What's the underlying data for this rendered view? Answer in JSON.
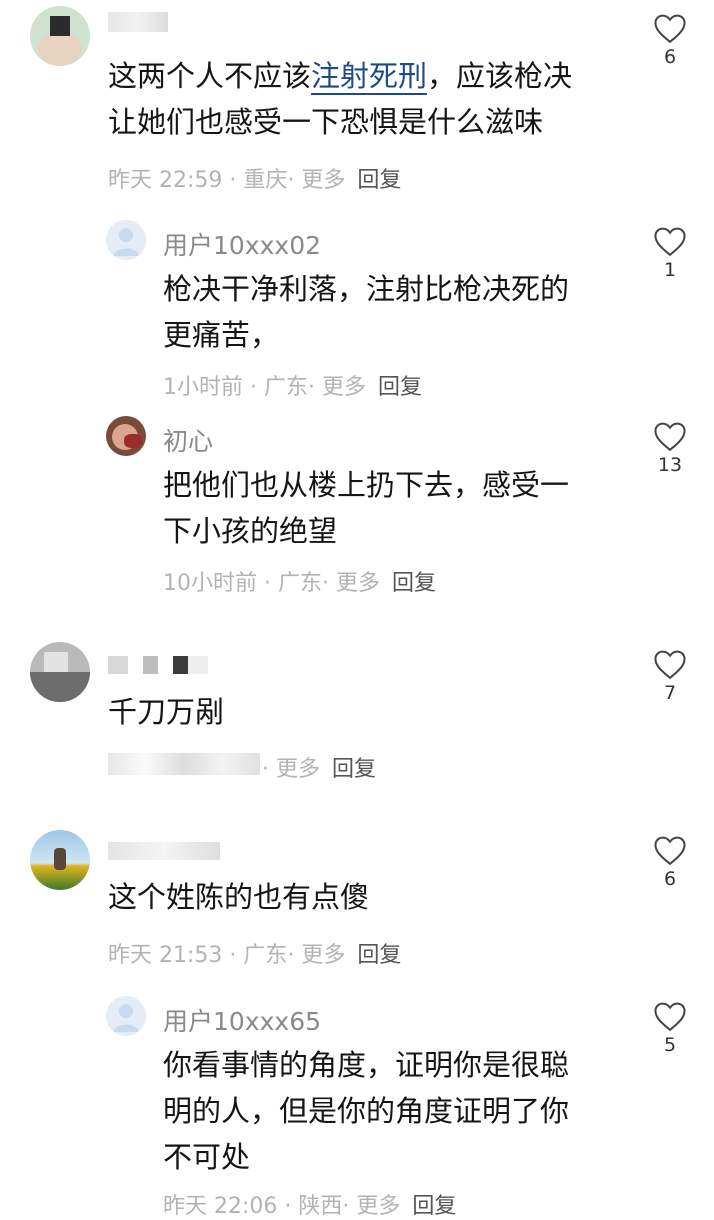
{
  "comments": [
    {
      "name": "",
      "text_before": "这两个人不应该",
      "text_link": "注射死刑",
      "text_after": "，应该枪决\n让她们也感受一下恐惧是什么滋味",
      "meta": "昨天 22:59 · 重庆· 更多",
      "reply": "回复",
      "likes": "6"
    },
    {
      "name": "用户10xxx02",
      "text": "枪决干净利落，注射比枪决死的\n更痛苦，",
      "meta": "1小时前 · 广东· 更多",
      "reply": "回复",
      "likes": "1"
    },
    {
      "name": "初心",
      "text": "把他们也从楼上扔下去，感受一\n下小孩的绝望",
      "meta": "10小时前 · 广东· 更多",
      "reply": "回复",
      "likes": "13"
    },
    {
      "name": "",
      "text": "千刀万剐",
      "meta": "· 更多",
      "reply": "回复",
      "likes": "7"
    },
    {
      "name": "",
      "text": "这个姓陈的也有点傻",
      "meta": "昨天 21:53 · 广东· 更多",
      "reply": "回复",
      "likes": "6"
    },
    {
      "name": "用户10xxx65",
      "text": "你看事情的角度，证明你是很聪\n明的人，但是你的角度证明了你\n不可处",
      "meta": "昨天 22:06 · 陕西· 更多",
      "reply": "回复",
      "likes": "5"
    }
  ],
  "icons": {
    "like": "heart-outline-icon",
    "default_avatar": "user-silhouette-icon"
  },
  "colors": {
    "link": "#1f4a8a",
    "meta": "#b3b3b3",
    "text": "#151515"
  }
}
